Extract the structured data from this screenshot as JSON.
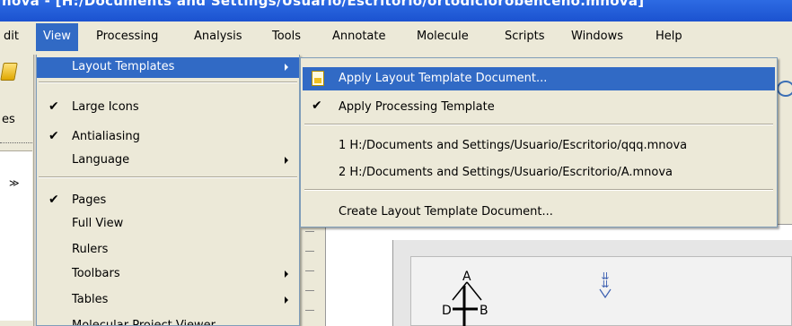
{
  "window": {
    "title": "nova - [H:/Documents and Settings/Usuario/Escritorio/ortodiclorobenceno.mnova]"
  },
  "menubar": {
    "items": [
      {
        "id": "edit",
        "label": "dit"
      },
      {
        "id": "view",
        "label": "View"
      },
      {
        "id": "processing",
        "label": "Processing"
      },
      {
        "id": "analysis",
        "label": "Analysis"
      },
      {
        "id": "tools",
        "label": "Tools"
      },
      {
        "id": "annotate",
        "label": "Annotate"
      },
      {
        "id": "molecule",
        "label": "Molecule"
      },
      {
        "id": "scripts",
        "label": "Scripts"
      },
      {
        "id": "windows",
        "label": "Windows"
      },
      {
        "id": "help",
        "label": "Help"
      }
    ]
  },
  "left_panel": {
    "label": "es",
    "glyph": "≫"
  },
  "view_menu": {
    "items": [
      {
        "label": "Layout Templates",
        "checked": false,
        "submenu": true
      },
      {
        "label": "Large Icons",
        "checked": true,
        "submenu": false
      },
      {
        "label": "Antialiasing",
        "checked": true,
        "submenu": false
      },
      {
        "label": "Language",
        "checked": false,
        "submenu": true
      },
      {
        "label": "Pages",
        "checked": true,
        "submenu": false
      },
      {
        "label": "Full View",
        "checked": false,
        "submenu": false
      },
      {
        "label": "Rulers",
        "checked": false,
        "submenu": false
      },
      {
        "label": "Toolbars",
        "checked": false,
        "submenu": true
      },
      {
        "label": "Tables",
        "checked": false,
        "submenu": true
      },
      {
        "label": "Molecular Project Viewer",
        "checked": false,
        "submenu": false
      }
    ],
    "check_glyph": "✔"
  },
  "layout_submenu": {
    "items": [
      {
        "label": "Apply Layout Template Document...",
        "icon": "document-icon"
      },
      {
        "label": "Apply Processing Template",
        "checked": true
      },
      {
        "label": "1 H:/Documents and Settings/Usuario/Escritorio/qqq.mnova"
      },
      {
        "label": "2 H:/Documents and Settings/Usuario/Escritorio/A.mnova"
      },
      {
        "label": "Create Layout Template Document..."
      }
    ]
  },
  "molecule": {
    "labels": [
      "A",
      "D",
      "B"
    ],
    "glyph2": "⇊"
  }
}
